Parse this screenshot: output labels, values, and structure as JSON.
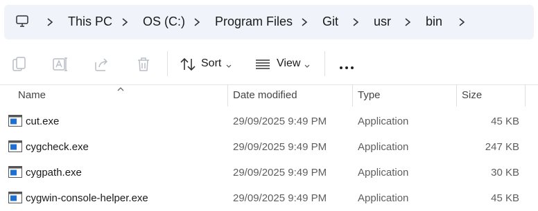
{
  "breadcrumb": {
    "icon": "this-pc-icon",
    "items": [
      "This PC",
      "OS (C:)",
      "Program Files",
      "Git",
      "usr",
      "bin"
    ]
  },
  "toolbar": {
    "copy_icon": "copy-icon",
    "rename_icon": "rename-icon",
    "share_icon": "share-icon",
    "delete_icon": "trash-icon",
    "sort_label": "Sort",
    "view_label": "View",
    "more_icon": "more-icon"
  },
  "columns": {
    "name": "Name",
    "date": "Date modified",
    "type": "Type",
    "size": "Size"
  },
  "files": [
    {
      "name": "cut.exe",
      "date": "29/09/2025 9:49 PM",
      "type": "Application",
      "size": "45 KB"
    },
    {
      "name": "cygcheck.exe",
      "date": "29/09/2025 9:49 PM",
      "type": "Application",
      "size": "247 KB"
    },
    {
      "name": "cygpath.exe",
      "date": "29/09/2025 9:49 PM",
      "type": "Application",
      "size": "30 KB"
    },
    {
      "name": "cygwin-console-helper.exe",
      "date": "29/09/2025 9:49 PM",
      "type": "Application",
      "size": "45 KB"
    }
  ],
  "colors": {
    "address_bg": "#f0f3f9",
    "icon_blue": "#1f6fd1"
  }
}
